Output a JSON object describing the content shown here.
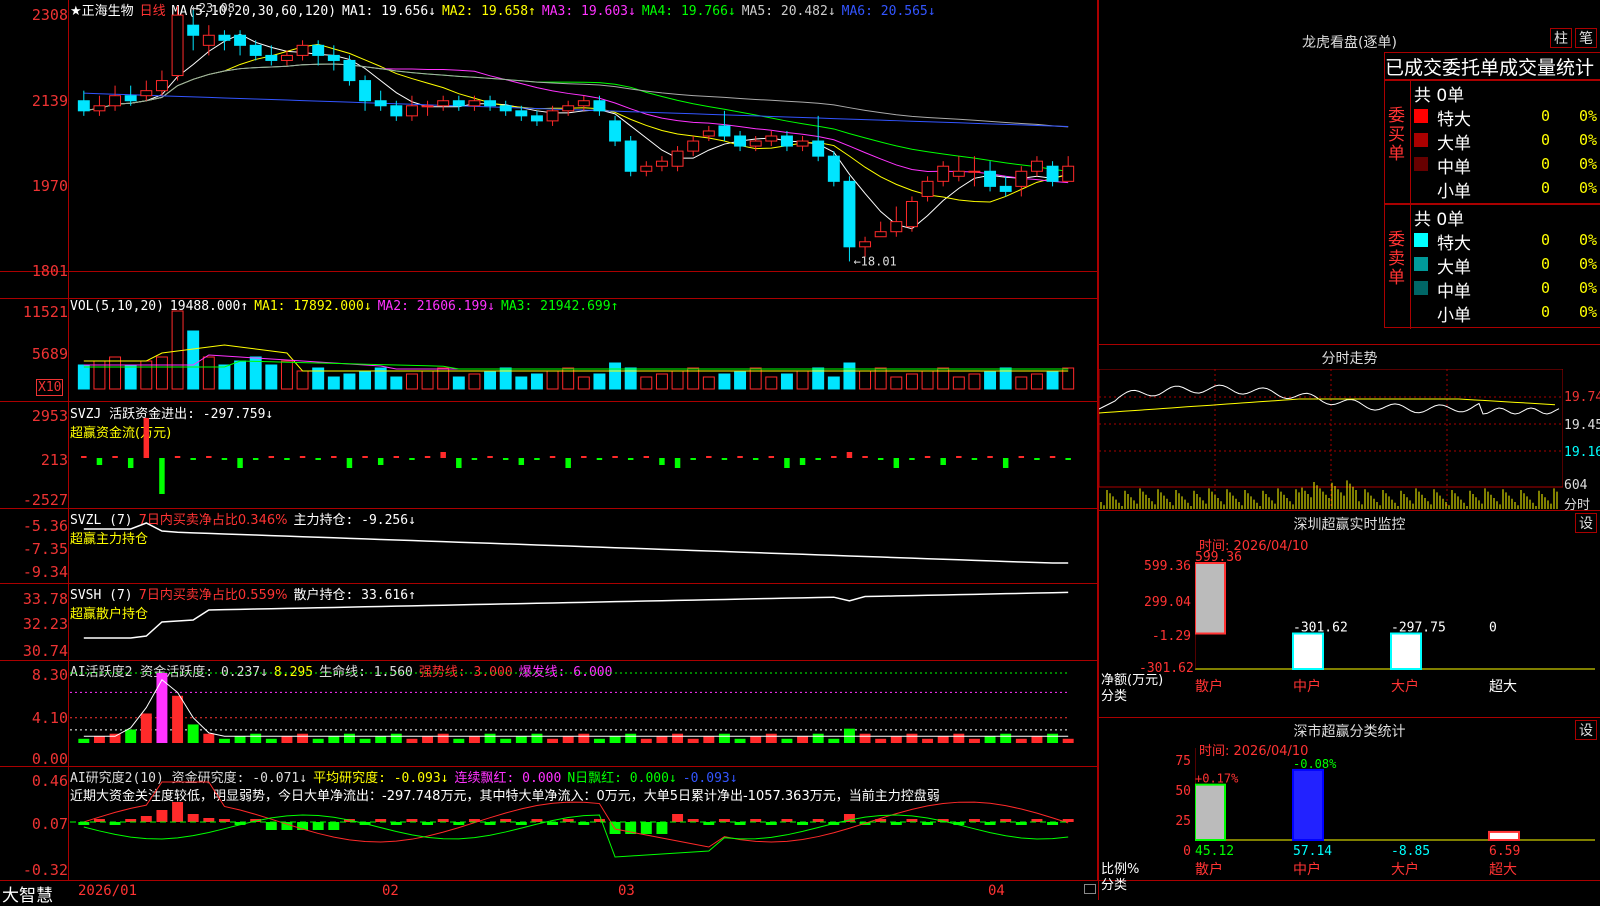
{
  "colors": {
    "up": "#ff2a2a",
    "down": "#00e5ff",
    "ma1": "#ffffff",
    "ma2": "#ffff00",
    "ma3": "#ff33ff",
    "ma4": "#00ff00",
    "ma5": "#aaaaaa",
    "ma6": "#3355ff",
    "axis": "#ff3333",
    "grid": "#aa0000"
  },
  "kline": {
    "stock_name": "★正海生物",
    "period": "日线",
    "ma_label": "MA(5,10,20,30,60,120)",
    "ma_items": [
      {
        "text": "MA1: 19.656↓",
        "color": "#ffffff"
      },
      {
        "text": "MA2: 19.658↑",
        "color": "#ffff00"
      },
      {
        "text": "MA3: 19.603↓",
        "color": "#ff33ff"
      },
      {
        "text": "MA4: 19.766↓",
        "color": "#00ff00"
      },
      {
        "text": "MA5: 20.482↓",
        "color": "#cccccc"
      },
      {
        "text": "MA6: 20.565↓",
        "color": "#3355ff"
      }
    ],
    "yticks": [
      "2308",
      "2139",
      "1970",
      "1801"
    ],
    "high_label": "23.08",
    "low_label": "18.01",
    "ylim": [
      17.8,
      23.2
    ],
    "candles": [
      [
        21.2,
        21.0,
        21.4,
        20.9
      ],
      [
        21.0,
        21.1,
        21.3,
        20.9
      ],
      [
        21.1,
        21.3,
        21.5,
        21.0
      ],
      [
        21.3,
        21.2,
        21.5,
        21.1
      ],
      [
        21.3,
        21.4,
        21.6,
        21.2
      ],
      [
        21.4,
        21.6,
        21.8,
        21.3
      ],
      [
        21.7,
        22.9,
        23.08,
        21.6
      ],
      [
        22.7,
        22.5,
        23.0,
        22.2
      ],
      [
        22.3,
        22.5,
        22.7,
        22.1
      ],
      [
        22.5,
        22.4,
        22.6,
        22.2
      ],
      [
        22.5,
        22.3,
        22.6,
        22.1
      ],
      [
        22.3,
        22.1,
        22.4,
        22.0
      ],
      [
        22.1,
        22.0,
        22.3,
        21.9
      ],
      [
        22.0,
        22.1,
        22.2,
        21.9
      ],
      [
        22.1,
        22.3,
        22.4,
        22.0
      ],
      [
        22.3,
        22.1,
        22.4,
        21.9
      ],
      [
        22.1,
        22.0,
        22.3,
        21.8
      ],
      [
        22.0,
        21.6,
        22.1,
        21.5
      ],
      [
        21.6,
        21.2,
        21.7,
        21.0
      ],
      [
        21.2,
        21.1,
        21.4,
        21.0
      ],
      [
        21.1,
        20.9,
        21.2,
        20.8
      ],
      [
        20.9,
        21.1,
        21.3,
        20.8
      ],
      [
        21.1,
        21.1,
        21.2,
        20.9
      ],
      [
        21.1,
        21.2,
        21.3,
        21.0
      ],
      [
        21.2,
        21.1,
        21.3,
        21.0
      ],
      [
        21.1,
        21.2,
        21.3,
        21.0
      ],
      [
        21.2,
        21.1,
        21.3,
        21.0
      ],
      [
        21.1,
        21.0,
        21.2,
        20.9
      ],
      [
        21.0,
        20.9,
        21.1,
        20.8
      ],
      [
        20.9,
        20.8,
        21.0,
        20.7
      ],
      [
        20.8,
        21.0,
        21.1,
        20.7
      ],
      [
        21.0,
        21.1,
        21.2,
        20.9
      ],
      [
        21.1,
        21.2,
        21.3,
        21.0
      ],
      [
        21.2,
        21.0,
        21.3,
        20.9
      ],
      [
        20.8,
        20.4,
        20.9,
        20.3
      ],
      [
        20.4,
        19.8,
        20.5,
        19.7
      ],
      [
        19.8,
        19.9,
        20.0,
        19.7
      ],
      [
        19.9,
        20.0,
        20.1,
        19.8
      ],
      [
        19.9,
        20.2,
        20.3,
        19.8
      ],
      [
        20.2,
        20.4,
        20.5,
        20.1
      ],
      [
        20.5,
        20.6,
        20.7,
        20.4
      ],
      [
        20.7,
        20.5,
        21.0,
        20.4
      ],
      [
        20.5,
        20.3,
        20.6,
        20.2
      ],
      [
        20.3,
        20.4,
        20.5,
        20.2
      ],
      [
        20.4,
        20.5,
        20.6,
        20.3
      ],
      [
        20.5,
        20.3,
        20.6,
        20.2
      ],
      [
        20.3,
        20.4,
        20.5,
        20.2
      ],
      [
        20.4,
        20.1,
        20.9,
        20.0
      ],
      [
        20.1,
        19.6,
        20.2,
        19.5
      ],
      [
        19.6,
        18.3,
        19.7,
        18.01
      ],
      [
        18.3,
        18.4,
        18.5,
        18.1
      ],
      [
        18.5,
        18.6,
        18.8,
        18.5
      ],
      [
        18.6,
        18.8,
        19.1,
        18.5
      ],
      [
        18.7,
        19.2,
        19.3,
        18.6
      ],
      [
        19.3,
        19.6,
        19.7,
        19.2
      ],
      [
        19.6,
        19.9,
        20.0,
        19.5
      ],
      [
        19.7,
        19.8,
        20.1,
        19.6
      ],
      [
        19.8,
        19.8,
        20.1,
        19.5
      ],
      [
        19.8,
        19.5,
        20.0,
        19.4
      ],
      [
        19.5,
        19.4,
        19.7,
        19.3
      ],
      [
        19.5,
        19.8,
        19.9,
        19.3
      ],
      [
        19.8,
        20.0,
        20.1,
        19.7
      ],
      [
        19.9,
        19.6,
        20.0,
        19.5
      ],
      [
        19.6,
        19.9,
        20.1,
        19.6
      ]
    ]
  },
  "volume": {
    "label": "VOL(5,10,20)",
    "value": "19488.000↑",
    "items": [
      {
        "text": "MA1: 17892.000↓",
        "color": "#ffff00"
      },
      {
        "text": "MA2: 21606.199↓",
        "color": "#ff33ff"
      },
      {
        "text": "MA3: 21942.699↑",
        "color": "#00ff00"
      }
    ],
    "yticks": [
      "11521",
      "5689"
    ],
    "unit": "X10"
  },
  "svzj": {
    "label": "SVZJ  活跃资金进出: -297.759↓",
    "sub": "超赢资金流(万元)",
    "yticks": [
      "2953",
      "213",
      "-2527"
    ]
  },
  "svzl": {
    "label1": "SVZL (7)",
    "label2": "7日内买卖净占比0.346%",
    "label3": "主力持仓: -9.256↓",
    "sub": "超赢主力持仓",
    "yticks": [
      "-5.36",
      "-7.35",
      "-9.34"
    ]
  },
  "svsh": {
    "label1": "SVSH (7)",
    "label2": "7日内买卖净占比0.559%",
    "label3": "散户持仓: 33.616↑",
    "sub": "超赢散户持仓",
    "yticks": [
      "33.78",
      "32.23",
      "30.74"
    ]
  },
  "ai1": {
    "items": [
      {
        "text": "AI活跃度2 资金活跃度: 0.237↓",
        "color": "#dddddd"
      },
      {
        "text": "8.295",
        "color": "#ffff00"
      },
      {
        "text": "生命线: 1.560",
        "color": "#dddddd"
      },
      {
        "text": "强势线: 3.000",
        "color": "#ff3333"
      },
      {
        "text": "爆发线: 6.000",
        "color": "#ff33ff"
      }
    ],
    "yticks": [
      "8.30",
      "4.10",
      "0.00"
    ]
  },
  "ai2": {
    "items": [
      {
        "text": "AI研究度2(10) 资金研究度: -0.071↓",
        "color": "#dddddd"
      },
      {
        "text": "平均研究度: -0.093↓",
        "color": "#ffff00"
      },
      {
        "text": "连续飘红: 0.000",
        "color": "#ff33ff"
      },
      {
        "text": "N日飘红: 0.000↓",
        "color": "#00ff00"
      },
      {
        "text": "-0.093↓",
        "color": "#3355ff"
      }
    ],
    "comment": "近期大资金关注度较低，明显弱势，今日大单净流出：-297.748万元，其中特大单净流入：0万元，大单5日累计净出-1057.363万元，当前主力控盘弱",
    "yticks": [
      "0.46",
      "0.07",
      "-0.32"
    ]
  },
  "bottom": {
    "brand": "大智慧",
    "dates": [
      "2026/01",
      "02",
      "03",
      "04"
    ]
  },
  "longhu": {
    "title": "龙虎看盘(逐单)",
    "btn_col": "柱",
    "btn_bi": "笔",
    "tabs": "已成交委托单成交量统计",
    "buy_label": "委买单",
    "sell_label": "委卖单",
    "buy_total": "共 0单",
    "sell_total": "共 0单",
    "buy_rows": [
      {
        "name": "特大",
        "n": "0",
        "pct": "0%",
        "color": "#ff0000"
      },
      {
        "name": "大单",
        "n": "0",
        "pct": "0%",
        "color": "#aa0000"
      },
      {
        "name": "中单",
        "n": "0",
        "pct": "0%",
        "color": "#660000"
      },
      {
        "name": "小单",
        "n": "0",
        "pct": "0%",
        "color": "#000000"
      }
    ],
    "sell_rows": [
      {
        "name": "特大",
        "n": "0",
        "pct": "0%",
        "color": "#00ffff"
      },
      {
        "name": "大单",
        "n": "0",
        "pct": "0%",
        "color": "#009999"
      },
      {
        "name": "中单",
        "n": "0",
        "pct": "0%",
        "color": "#006666"
      },
      {
        "name": "小单",
        "n": "0",
        "pct": "0%",
        "color": "#000000"
      }
    ]
  },
  "fenshi": {
    "title": "分时走势",
    "yticks": [
      "19.74",
      "19.45",
      "19.16"
    ],
    "vol_tick": "604",
    "vol_label": "分时"
  },
  "monitor": {
    "title": "深圳超赢实时监控",
    "btn": "设",
    "time": "时间: 2026/04/10",
    "yticks": [
      "599.36",
      "299.04",
      "-1.29",
      "-301.62"
    ],
    "ylabel1": "净额(万元)",
    "ylabel2": "分类",
    "cats": [
      "散户",
      "中户",
      "大户",
      "超大"
    ],
    "values": [
      599.36,
      -301.62,
      -297.75,
      0
    ],
    "value_labels": [
      "599.36",
      "-301.62",
      "-297.75",
      "0"
    ]
  },
  "classify": {
    "title": "深市超赢分类统计",
    "btn": "设",
    "time": "时间: 2026/04/10",
    "yticks": [
      "75",
      "50",
      "25",
      "0"
    ],
    "ylabel1": "比例%",
    "ylabel2": "分类",
    "cats": [
      "散户",
      "中户",
      "大户",
      "超大"
    ],
    "values": [
      45.12,
      57.14,
      -8.85,
      6.59
    ],
    "top_labels": [
      "+0.17%",
      "-0.08%",
      "",
      ""
    ],
    "bottom_labels": [
      "45.12",
      "57.14",
      "-8.85",
      "6.59"
    ]
  }
}
